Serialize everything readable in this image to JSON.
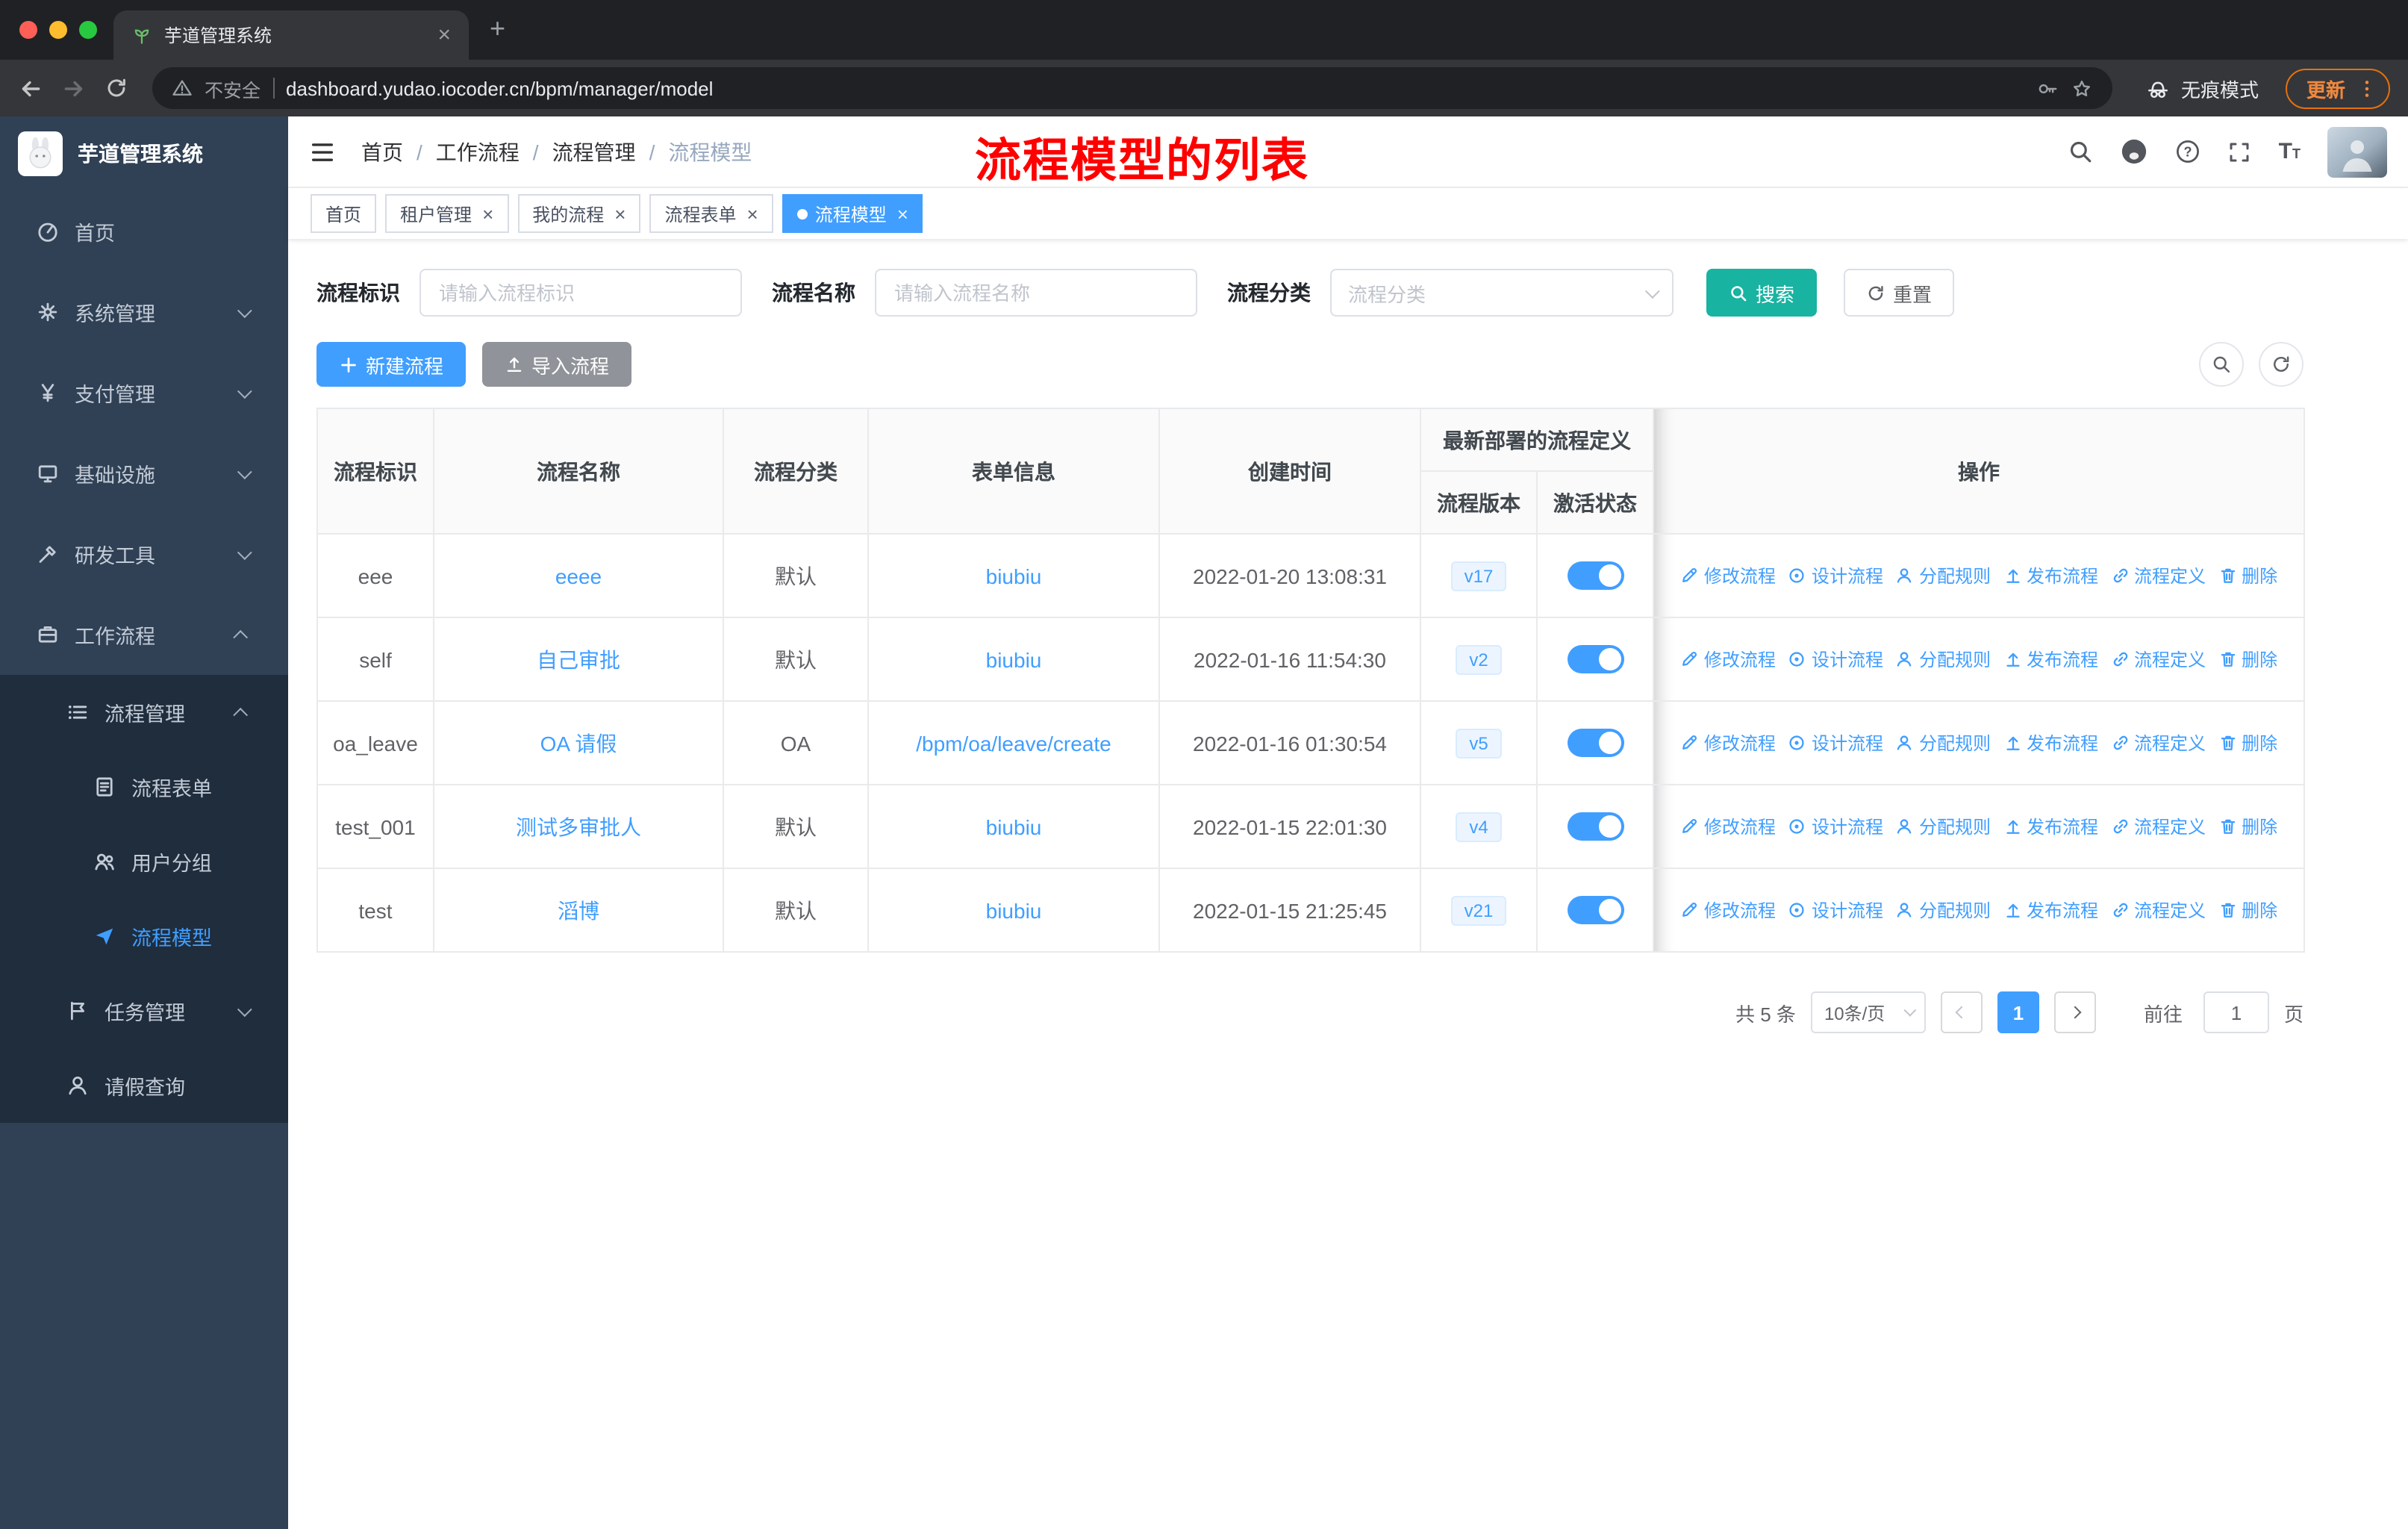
{
  "colors": {
    "primary": "#409eff",
    "search_button_teal": "#18b3a1",
    "sidebar_bg": "#304156",
    "sidebar_sub_bg": "#1f2d3d",
    "annotation_red": "#ff0000",
    "link_blue": "#409eff",
    "update_pill_orange": "#e8710a"
  },
  "browser": {
    "tab_title": "芋道管理系统",
    "security_label": "不安全",
    "url": "dashboard.yudao.iocoder.cn/bpm/manager/model",
    "incognito_label": "无痕模式",
    "update_button": "更新"
  },
  "sidebar": {
    "logo_title": "芋道管理系统",
    "items": [
      {
        "key": "home",
        "label": "首页",
        "icon": "dashboard-icon",
        "level": 1
      },
      {
        "key": "system",
        "label": "系统管理",
        "icon": "gear-icon",
        "level": 1,
        "arrow": "down"
      },
      {
        "key": "payment",
        "label": "支付管理",
        "icon": "yen-icon",
        "level": 1,
        "arrow": "down"
      },
      {
        "key": "infrastructure",
        "label": "基础设施",
        "icon": "monitor-icon",
        "level": 1,
        "arrow": "down"
      },
      {
        "key": "dev-tools",
        "label": "研发工具",
        "icon": "tools-icon",
        "level": 1,
        "arrow": "down"
      },
      {
        "key": "workflow",
        "label": "工作流程",
        "icon": "briefcase-icon",
        "level": 1,
        "arrow": "up"
      },
      {
        "key": "process-management",
        "label": "流程管理",
        "icon": "list-icon",
        "level": 2,
        "arrow": "up"
      },
      {
        "key": "process-form",
        "label": "流程表单",
        "icon": "document-icon",
        "level": 3
      },
      {
        "key": "user-group",
        "label": "用户分组",
        "icon": "users-icon",
        "level": 3
      },
      {
        "key": "process-model",
        "label": "流程模型",
        "icon": "send-icon",
        "level": 3,
        "active": true
      },
      {
        "key": "task-management",
        "label": "任务管理",
        "icon": "flag-icon",
        "level": 2,
        "arrow": "down"
      },
      {
        "key": "leave-query",
        "label": "请假查询",
        "icon": "user-icon",
        "level": 2
      }
    ]
  },
  "header": {
    "breadcrumb": [
      "首页",
      "工作流程",
      "流程管理",
      "流程模型"
    ],
    "annotation": "流程模型的列表"
  },
  "tags": [
    {
      "key": "home",
      "label": "首页",
      "closable": false,
      "active": false
    },
    {
      "key": "tenant-management",
      "label": "租户管理",
      "closable": true,
      "active": false
    },
    {
      "key": "my-process",
      "label": "我的流程",
      "closable": true,
      "active": false
    },
    {
      "key": "process-form",
      "label": "流程表单",
      "closable": true,
      "active": false
    },
    {
      "key": "process-model",
      "label": "流程模型",
      "closable": true,
      "active": true
    }
  ],
  "filters": {
    "id_label": "流程标识",
    "id_placeholder": "请输入流程标识",
    "name_label": "流程名称",
    "name_placeholder": "请输入流程名称",
    "category_label": "流程分类",
    "category_placeholder": "流程分类",
    "search_label": "搜索",
    "reset_label": "重置"
  },
  "toolbar": {
    "create_label": "新建流程",
    "import_label": "导入流程"
  },
  "table": {
    "group_header": "最新部署的流程定义",
    "columns": [
      "流程标识",
      "流程名称",
      "流程分类",
      "表单信息",
      "创建时间",
      "流程版本",
      "激活状态",
      "操作"
    ],
    "actions": [
      "修改流程",
      "设计流程",
      "分配规则",
      "发布流程",
      "流程定义",
      "删除"
    ],
    "rows": [
      {
        "id": "eee",
        "name": "eeee",
        "category": "默认",
        "form": "biubiu",
        "created": "2022-01-20 13:08:31",
        "version": "v17",
        "active": true
      },
      {
        "id": "self",
        "name": "自己审批",
        "category": "默认",
        "form": "biubiu",
        "created": "2022-01-16 11:54:30",
        "version": "v2",
        "active": true
      },
      {
        "id": "oa_leave",
        "name": "OA 请假",
        "category": "OA",
        "form": "/bpm/oa/leave/create",
        "created": "2022-01-16 01:30:54",
        "version": "v5",
        "active": true
      },
      {
        "id": "test_001",
        "name": "测试多审批人",
        "category": "默认",
        "form": "biubiu",
        "created": "2022-01-15 22:01:30",
        "version": "v4",
        "active": true
      },
      {
        "id": "test",
        "name": "滔博",
        "category": "默认",
        "form": "biubiu",
        "created": "2022-01-15 21:25:45",
        "version": "v21",
        "active": true
      }
    ]
  },
  "pagination": {
    "total": "共 5 条",
    "page_size": "10条/页",
    "current": "1",
    "goto_label": "前往",
    "goto_value": "1",
    "page_label": "页"
  }
}
